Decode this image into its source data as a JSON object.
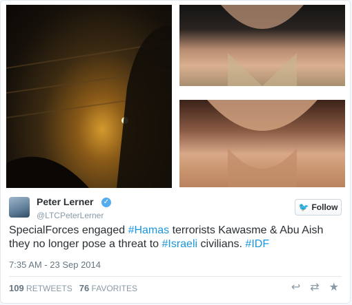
{
  "user": {
    "name": "Peter Lerner",
    "handle": "@LTCPeterLerner"
  },
  "follow_label": "Follow",
  "tweet": {
    "parts": [
      "SpecialForces engaged ",
      "#Hamas",
      " terrorists Kawasme & Abu Aish they no longer pose a threat to ",
      "#Israeli",
      " civilians. ",
      "#IDF"
    ],
    "timestamp": "7:35 AM - 23 Sep 2014"
  },
  "stats": {
    "retweets_count": "109",
    "retweets_label": "RETWEETS",
    "favorites_count": "76",
    "favorites_label": "FAVORITES"
  },
  "icons": {
    "reply": "reply-icon",
    "retweet": "retweet-icon",
    "favorite": "star-icon",
    "verified": "verified-badge-icon",
    "bird": "twitter-bird-icon"
  },
  "colors": {
    "link": "#1b95e0",
    "verified": "#55acee"
  }
}
